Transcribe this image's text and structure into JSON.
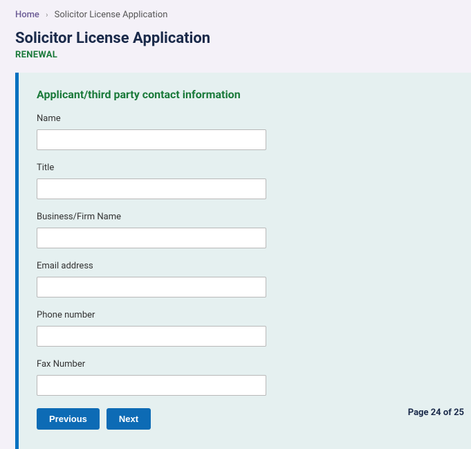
{
  "breadcrumb": {
    "home": "Home",
    "current": "Solicitor License Application"
  },
  "header": {
    "title": "Solicitor License Application",
    "subheading": "RENEWAL"
  },
  "section": {
    "title": "Applicant/third party contact information"
  },
  "fields": {
    "name": {
      "label": "Name",
      "value": ""
    },
    "title": {
      "label": "Title",
      "value": ""
    },
    "business": {
      "label": "Business/Firm Name",
      "value": ""
    },
    "email": {
      "label": "Email address",
      "value": ""
    },
    "phone": {
      "label": "Phone number",
      "value": ""
    },
    "fax": {
      "label": "Fax Number",
      "value": ""
    }
  },
  "buttons": {
    "previous": "Previous",
    "next": "Next"
  },
  "pageIndicator": "Page 24 of 25"
}
